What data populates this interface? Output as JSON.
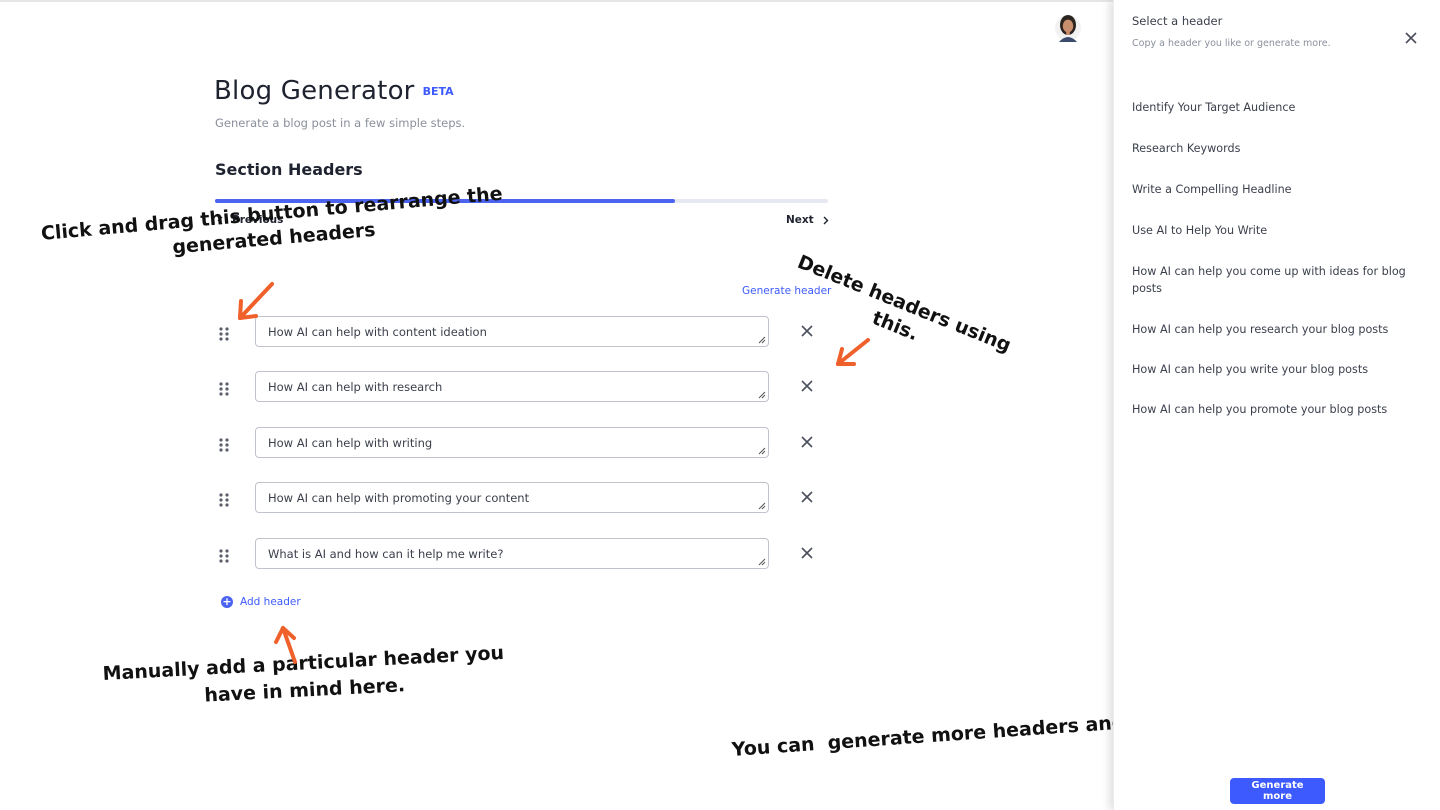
{
  "app": {
    "title": "Blog Generator",
    "badge": "BETA",
    "subtitle": "Generate a blog post in a few simple steps.",
    "accent_color": "#3d5afe"
  },
  "step": {
    "title": "Section Headers",
    "progress_fraction": 0.75,
    "prev_label": "Previous",
    "next_label": "Next"
  },
  "headers": {
    "generate_link": "Generate header",
    "items": [
      "How AI can help with content ideation",
      "How AI can help with research",
      "How AI can help with writing",
      "How AI can help with promoting your content",
      "What is AI and how can it help me write?"
    ],
    "add_label": "Add header"
  },
  "panel": {
    "title": "Select a header",
    "subtitle": "Copy a header you like or generate more.",
    "suggestions": [
      "Identify Your Target Audience",
      "Research Keywords",
      "Write a Compelling Headline",
      "Use AI to Help You Write",
      "How AI can help you come up with ideas for blog posts",
      "How AI can help you research your blog posts",
      "How AI can help you write your blog posts",
      "How AI can help you promote your blog posts"
    ],
    "generate_more_label": "Generate more"
  },
  "annotations": {
    "drag": {
      "line1": "Click and drag this button to rearrange the",
      "line2": "generated headers"
    },
    "delete": {
      "line1": "Delete headers using",
      "line2": "this."
    },
    "add": {
      "line1": "Manually add a particular header you",
      "line2": "have in mind here."
    },
    "more": "You can  generate more headers and it will appear here.",
    "arrow_color": "#f0602a"
  },
  "icons": {
    "drag": "drag-handle-icon",
    "delete": "close-icon",
    "add": "plus-circle-icon",
    "prev": "chevron-left-icon",
    "next": "chevron-right-icon",
    "user": "avatar"
  }
}
